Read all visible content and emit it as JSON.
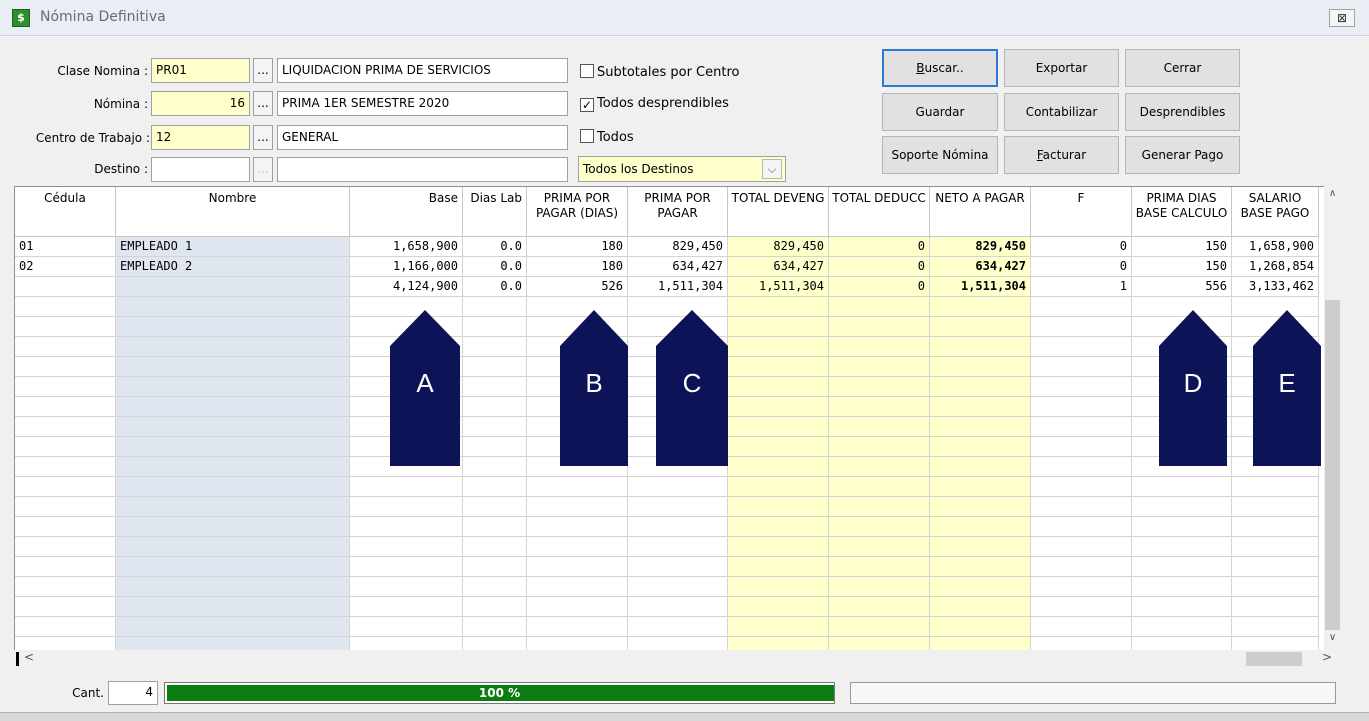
{
  "window": {
    "title": "Nómina Definitiva",
    "close_glyph": "⊠"
  },
  "form": {
    "clase_nomina": {
      "label": "Clase Nomina :",
      "code": "PR01",
      "desc": "LIQUIDACION PRIMA DE SERVICIOS"
    },
    "nomina": {
      "label": "Nómina :",
      "code": "16",
      "desc": "PRIMA 1ER SEMESTRE 2020"
    },
    "centro": {
      "label": "Centro de Trabajo :",
      "code": "12",
      "desc": "GENERAL"
    },
    "destino": {
      "label": "Destino :",
      "code": "",
      "desc": ""
    },
    "dots": "...",
    "checkboxes": [
      {
        "label": "Subtotales por Centro",
        "checked": false
      },
      {
        "label": "Todos desprendibles",
        "checked": true
      },
      {
        "label": "Todos",
        "checked": false
      }
    ],
    "destinos_select": "Todos los Destinos",
    "check_mark": "✓"
  },
  "buttons": {
    "buscar_u": "B",
    "buscar_rest": "uscar..",
    "exportar": "Exportar",
    "cerrar": "Cerrar",
    "guardar": "Guardar",
    "contabilizar": "Contabilizar",
    "desprendibles": "Desprendibles",
    "soporte": "Soporte Nómina",
    "facturar_u": "F",
    "facturar_rest": "acturar",
    "generar": "Generar Pago"
  },
  "grid": {
    "headers": {
      "cedula": "Cédula",
      "nombre": "Nombre",
      "base": "Base",
      "dias_lab": "Dias Lab",
      "prima_dias": "PRIMA POR PAGAR (DIAS)",
      "prima_pagar": "PRIMA POR PAGAR",
      "total_deveng": "TOTAL DEVENG",
      "total_deduc": "TOTAL DEDUCC",
      "neto": "NETO A PAGAR",
      "f": "F",
      "prima_base": "PRIMA DIAS BASE CALCULO",
      "salario": "SALARIO BASE PAGO"
    },
    "rows": [
      {
        "cedula": "01",
        "nombre": "EMPLEADO 1",
        "base": "1,658,900",
        "dias_lab": "0.0",
        "prima_dias": "180",
        "prima_pagar": "829,450",
        "total_deveng": "829,450",
        "total_deduc": "0",
        "neto": "829,450",
        "f": "0",
        "prima_base": "150",
        "salario": "1,658,900"
      },
      {
        "cedula": "02",
        "nombre": "EMPLEADO 2",
        "base": "1,166,000",
        "dias_lab": "0.0",
        "prima_dias": "180",
        "prima_pagar": "634,427",
        "total_deveng": "634,427",
        "total_deduc": "0",
        "neto": "634,427",
        "f": "0",
        "prima_base": "150",
        "salario": "1,268,854"
      },
      {
        "cedula": "",
        "nombre": "",
        "base": "4,124,900",
        "dias_lab": "0.0",
        "prima_dias": "526",
        "prima_pagar": "1,511,304",
        "total_deveng": "1,511,304",
        "total_deduc": "0",
        "neto": "1,511,304",
        "f": "1",
        "prima_base": "556",
        "salario": "3,133,462"
      }
    ],
    "markers": [
      "A",
      "B",
      "C",
      "D",
      "E"
    ]
  },
  "scroll": {
    "up": "∧",
    "down": "∨",
    "left": "<",
    "right": ">"
  },
  "status": {
    "cant_label": "Cant.",
    "cant_value": "4",
    "progress_text": "100 %",
    "progress_value": 100
  }
}
